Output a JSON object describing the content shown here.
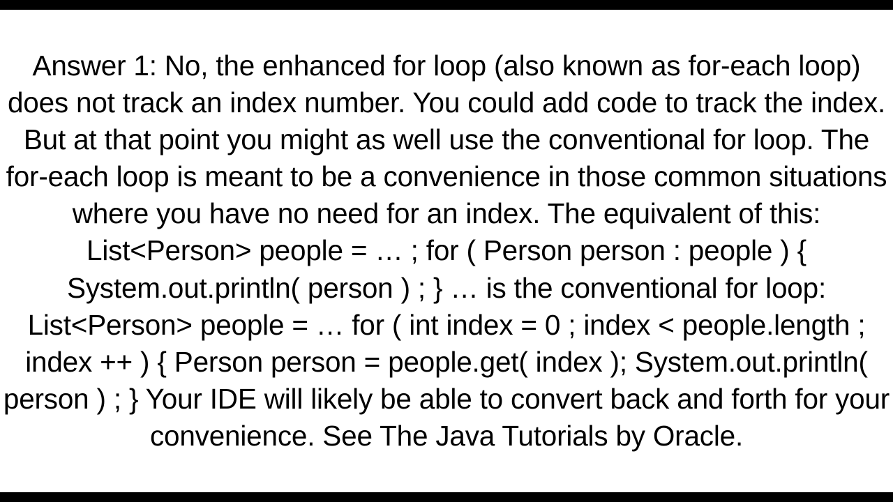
{
  "answer": {
    "text": "Answer 1: No, the enhanced for loop (also known as for-each loop) does not track an index number. You could add code to track the index.  But at that point you might as well use the conventional for loop. The for-each loop is meant to be a convenience in those common situations where you have no need for an index. The equivalent of this: List<Person> people = … ;  for ( Person person : people ) {     System.out.println( person ) ; }  … is the conventional for loop: List<Person> people = …  for ( int index = 0 ; index < people.length ; index ++ ) {     Person person = people.get( index );     System.out.println( person ) ; }  Your IDE will likely be able to convert back and forth for your convenience. See The Java Tutorials by Oracle."
  }
}
